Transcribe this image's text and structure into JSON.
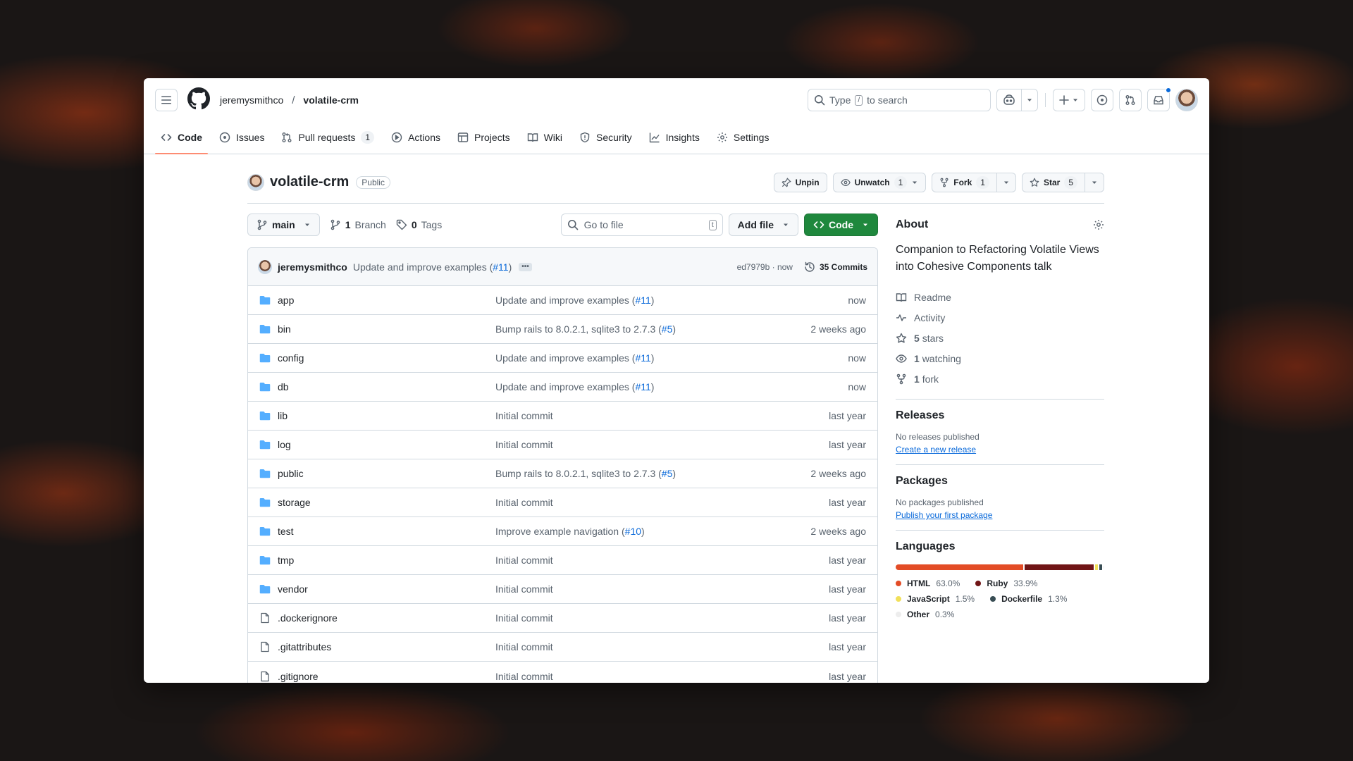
{
  "header": {
    "owner": "jeremysmithco",
    "separator": "/",
    "repo": "volatile-crm",
    "search_prefix": "Type",
    "search_key": "/",
    "search_suffix": "to search"
  },
  "tabs": [
    {
      "label": "Code",
      "icon": "code-icon",
      "active": true
    },
    {
      "label": "Issues",
      "icon": "issue-icon"
    },
    {
      "label": "Pull requests",
      "icon": "pull-request-icon",
      "count": "1"
    },
    {
      "label": "Actions",
      "icon": "play-icon"
    },
    {
      "label": "Projects",
      "icon": "table-icon"
    },
    {
      "label": "Wiki",
      "icon": "book-icon"
    },
    {
      "label": "Security",
      "icon": "shield-icon"
    },
    {
      "label": "Insights",
      "icon": "graph-icon"
    },
    {
      "label": "Settings",
      "icon": "gear-icon"
    }
  ],
  "repo_header": {
    "name": "volatile-crm",
    "visibility": "Public",
    "unpin": "Unpin",
    "unwatch": "Unwatch",
    "unwatch_count": "1",
    "fork": "Fork",
    "fork_count": "1",
    "star": "Star",
    "star_count": "5"
  },
  "controls": {
    "branch": "main",
    "branches_count": "1",
    "branches_label": "Branch",
    "tags_count": "0",
    "tags_label": "Tags",
    "goto_placeholder": "Go to file",
    "goto_key": "t",
    "add_file": "Add file",
    "code": "Code"
  },
  "latest_commit": {
    "author": "jeremysmithco",
    "message": "Update and improve examples (",
    "pr": "#11",
    "message_end": ")",
    "ellipsis": "•••",
    "sha_time": "ed7979b · now",
    "commits": "35 Commits"
  },
  "files": [
    {
      "name": "app",
      "type": "dir",
      "msg": "Update and improve examples (",
      "pr": "#11",
      "end": ")",
      "date": "now"
    },
    {
      "name": "bin",
      "type": "dir",
      "msg": "Bump rails to 8.0.2.1, sqlite3 to 2.7.3 (",
      "pr": "#5",
      "end": ")",
      "date": "2 weeks ago"
    },
    {
      "name": "config",
      "type": "dir",
      "msg": "Update and improve examples (",
      "pr": "#11",
      "end": ")",
      "date": "now"
    },
    {
      "name": "db",
      "type": "dir",
      "msg": "Update and improve examples (",
      "pr": "#11",
      "end": ")",
      "date": "now"
    },
    {
      "name": "lib",
      "type": "dir",
      "msg": "Initial commit",
      "pr": "",
      "end": "",
      "date": "last year"
    },
    {
      "name": "log",
      "type": "dir",
      "msg": "Initial commit",
      "pr": "",
      "end": "",
      "date": "last year"
    },
    {
      "name": "public",
      "type": "dir",
      "msg": "Bump rails to 8.0.2.1, sqlite3 to 2.7.3 (",
      "pr": "#5",
      "end": ")",
      "date": "2 weeks ago"
    },
    {
      "name": "storage",
      "type": "dir",
      "msg": "Initial commit",
      "pr": "",
      "end": "",
      "date": "last year"
    },
    {
      "name": "test",
      "type": "dir",
      "msg": "Improve example navigation (",
      "pr": "#10",
      "end": ")",
      "date": "2 weeks ago"
    },
    {
      "name": "tmp",
      "type": "dir",
      "msg": "Initial commit",
      "pr": "",
      "end": "",
      "date": "last year"
    },
    {
      "name": "vendor",
      "type": "dir",
      "msg": "Initial commit",
      "pr": "",
      "end": "",
      "date": "last year"
    },
    {
      "name": ".dockerignore",
      "type": "file",
      "msg": "Initial commit",
      "pr": "",
      "end": "",
      "date": "last year"
    },
    {
      "name": ".gitattributes",
      "type": "file",
      "msg": "Initial commit",
      "pr": "",
      "end": "",
      "date": "last year"
    },
    {
      "name": ".gitignore",
      "type": "file",
      "msg": "Initial commit",
      "pr": "",
      "end": "",
      "date": "last year"
    }
  ],
  "about": {
    "title": "About",
    "description": "Companion to Refactoring Volatile Views into Cohesive Components talk",
    "readme": "Readme",
    "activity": "Activity",
    "stars_count": "5",
    "stars_label": "stars",
    "watching_count": "1",
    "watching_label": "watching",
    "forks_count": "1",
    "forks_label": "fork"
  },
  "releases": {
    "title": "Releases",
    "empty": "No releases published",
    "link": "Create a new release"
  },
  "packages": {
    "title": "Packages",
    "empty": "No packages published",
    "link": "Publish your first package"
  },
  "languages": {
    "title": "Languages",
    "items": [
      {
        "name": "HTML",
        "pct": "63.0%",
        "value": 63.0,
        "color": "#e34c26"
      },
      {
        "name": "Ruby",
        "pct": "33.9%",
        "value": 33.9,
        "color": "#701516"
      },
      {
        "name": "JavaScript",
        "pct": "1.5%",
        "value": 1.5,
        "color": "#f1e05a"
      },
      {
        "name": "Dockerfile",
        "pct": "1.3%",
        "value": 1.3,
        "color": "#384d54"
      },
      {
        "name": "Other",
        "pct": "0.3%",
        "value": 0.3,
        "color": "#ededed"
      }
    ]
  }
}
